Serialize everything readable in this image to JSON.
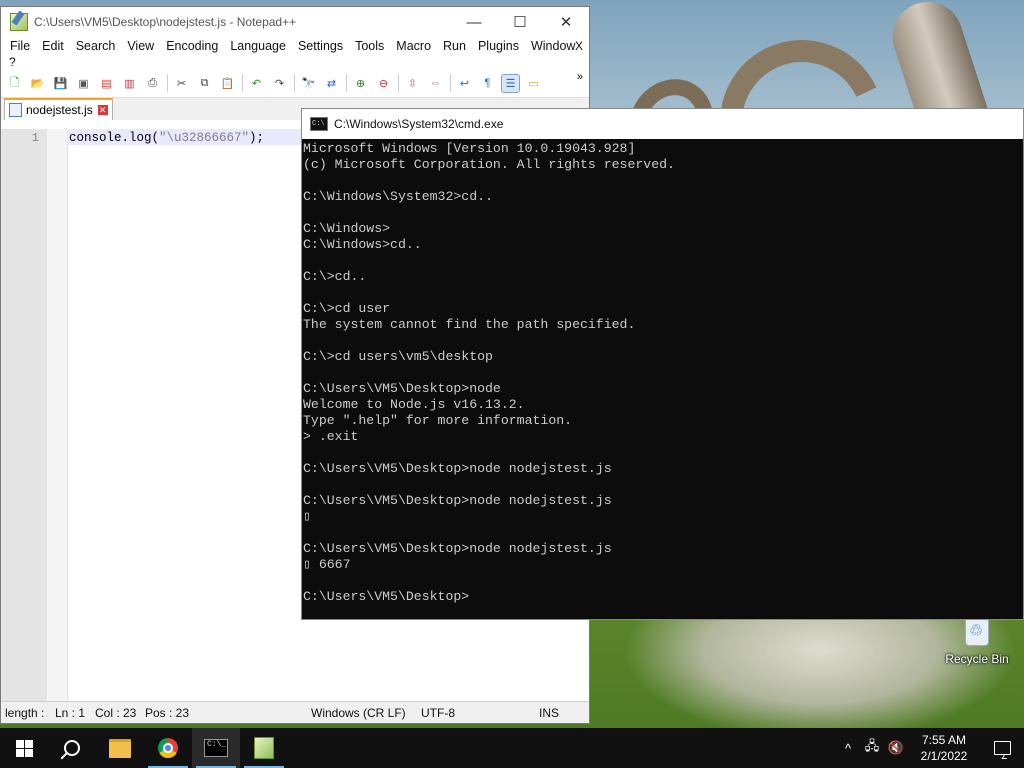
{
  "notepad": {
    "title": "C:\\Users\\VM5\\Desktop\\nodejstest.js - Notepad++",
    "menu": [
      "File",
      "Edit",
      "Search",
      "View",
      "Encoding",
      "Language",
      "Settings",
      "Tools",
      "Macro",
      "Run",
      "Plugins",
      "Window"
    ],
    "menu_overflow": "?",
    "menu_close": "X",
    "toolbar_more": "»",
    "tab_label": "nodejstest.js",
    "line_number": "1",
    "code": {
      "fn": "console.log(",
      "str": "\"\\u32866667\"",
      "end": ");"
    },
    "status": {
      "length": "length : ",
      "ln": "Ln : 1",
      "col": "Col : 23",
      "pos": "Pos : 23",
      "eol": "Windows (CR LF)",
      "encoding": "UTF-8",
      "mode": "INS"
    }
  },
  "cmd": {
    "title": "C:\\Windows\\System32\\cmd.exe",
    "lines": [
      "Microsoft Windows [Version 10.0.19043.928]",
      "(c) Microsoft Corporation. All rights reserved.",
      "",
      "C:\\Windows\\System32>cd..",
      "",
      "C:\\Windows>",
      "C:\\Windows>cd..",
      "",
      "C:\\>cd..",
      "",
      "C:\\>cd user",
      "The system cannot find the path specified.",
      "",
      "C:\\>cd users\\vm5\\desktop",
      "",
      "C:\\Users\\VM5\\Desktop>node",
      "Welcome to Node.js v16.13.2.",
      "Type \".help\" for more information.",
      "> .exit",
      "",
      "C:\\Users\\VM5\\Desktop>node nodejstest.js",
      "",
      "C:\\Users\\VM5\\Desktop>node nodejstest.js",
      "▯",
      "",
      "C:\\Users\\VM5\\Desktop>node nodejstest.js",
      "▯ 6667",
      "",
      "C:\\Users\\VM5\\Desktop>"
    ]
  },
  "desktop": {
    "recycle_bin": "Recycle Bin"
  },
  "taskbar": {
    "time": "7:55 AM",
    "date": "2/1/2022",
    "tray_up": "^",
    "tray_network": "🖧",
    "tray_volume": "🔇"
  }
}
